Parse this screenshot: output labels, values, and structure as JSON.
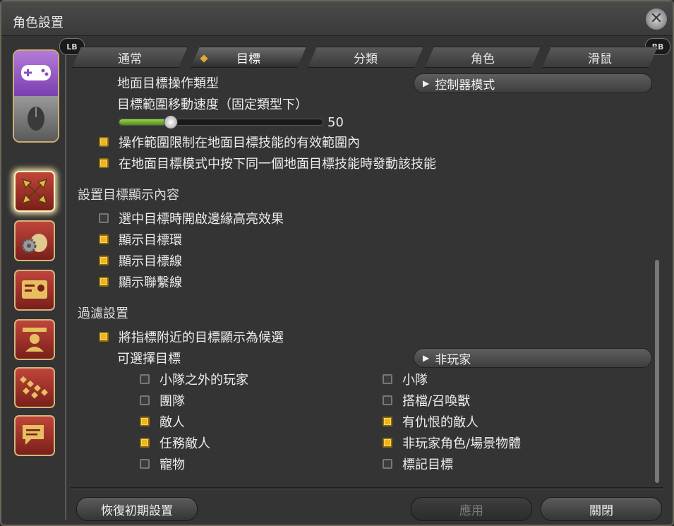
{
  "window": {
    "title": "角色設置"
  },
  "shoulder": {
    "left": "LB",
    "right": "RB"
  },
  "tabs": [
    {
      "label": "通常",
      "active": false
    },
    {
      "label": "目標",
      "active": true
    },
    {
      "label": "分類",
      "active": false
    },
    {
      "label": "角色",
      "active": false
    },
    {
      "label": "滑鼠",
      "active": false
    }
  ],
  "ground": {
    "op_type_label": "地面目標操作類型",
    "op_type_value": "控制器模式",
    "speed_label": "目標範圍移動速度（固定類型下）",
    "speed_value": "50",
    "speed_level": 0.25,
    "options": [
      {
        "label": "操作範圍限制在地面目標技能的有效範圍內",
        "checked": true
      },
      {
        "label": "在地面目標模式中按下同一個地面目標技能時發動該技能",
        "checked": true
      }
    ]
  },
  "display": {
    "heading": "設置目標顯示內容",
    "options": [
      {
        "label": "選中目標時開啟邊緣高亮效果",
        "checked": false
      },
      {
        "label": "顯示目標環",
        "checked": true
      },
      {
        "label": "顯示目標線",
        "checked": true
      },
      {
        "label": "顯示聯繫線",
        "checked": true
      }
    ]
  },
  "filter": {
    "heading": "過濾設置",
    "near_label": "將指標附近的目標顯示為候選",
    "near_checked": true,
    "selectable_label": "可選擇目標",
    "selectable_value": "非玩家",
    "left": [
      {
        "label": "小隊之外的玩家",
        "checked": false
      },
      {
        "label": "團隊",
        "checked": false
      },
      {
        "label": "敵人",
        "checked": true
      },
      {
        "label": "任務敵人",
        "checked": true
      },
      {
        "label": "寵物",
        "checked": false
      }
    ],
    "right": [
      {
        "label": "小隊",
        "checked": false
      },
      {
        "label": "搭檔/召喚獸",
        "checked": false
      },
      {
        "label": "有仇恨的敵人",
        "checked": true
      },
      {
        "label": "非玩家角色/場景物體",
        "checked": true
      },
      {
        "label": "標記目標",
        "checked": false
      }
    ]
  },
  "footer": {
    "reset": "恢復初期設置",
    "apply": "應用",
    "close": "關閉"
  },
  "icons": [
    "gamepad-icon",
    "mouse-icon",
    "crossed-arrows-icon",
    "gear-bag-icon",
    "id-card-icon",
    "character-icon",
    "checker-icon",
    "chat-bubbles-icon",
    "close-icon"
  ]
}
